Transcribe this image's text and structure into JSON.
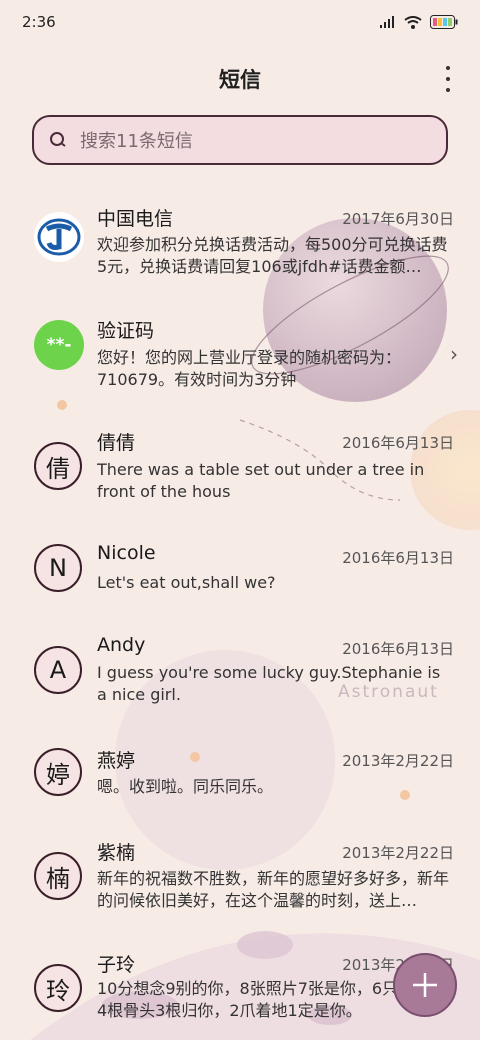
{
  "status_bar": {
    "time": "2:36"
  },
  "header": {
    "title": "短信",
    "more_icon": "more-vert-icon"
  },
  "search": {
    "placeholder": "搜索11条短信"
  },
  "watermark": "Astronaut",
  "messages": [
    {
      "name": "中国电信",
      "date": "2017年6月30日",
      "snippet": "欢迎参加积分兑换话费活动，每500分可兑换话费5元，兑换话费请回复106或jfdh#话费金额…",
      "avatar": "china-telecom-logo"
    },
    {
      "name": "验证码",
      "date": "",
      "snippet": "您好！您的网上营业厅登录的随机密码为：710679。有效时间为3分钟",
      "avatar_text": "**-"
    },
    {
      "name": "倩倩",
      "date": "2016年6月13日",
      "snippet": "There was a table set out under a tree in front of the hous",
      "avatar_text": "倩"
    },
    {
      "name": "Nicole",
      "date": "2016年6月13日",
      "snippet": "Let's eat out,shall we?",
      "avatar_text": "N"
    },
    {
      "name": "Andy",
      "date": "2016年6月13日",
      "snippet": "I guess you're some lucky guy.Stephanie is a nice girl.",
      "avatar_text": "A"
    },
    {
      "name": "燕婷",
      "date": "2013年2月22日",
      "snippet": "嗯。收到啦。同乐同乐。",
      "avatar_text": "婷"
    },
    {
      "name": "紫楠",
      "date": "2013年2月22日",
      "snippet": "新年的祝福数不胜数，新年的愿望好多好多，新年的问候依旧美好，在这个温馨的时刻，送上…",
      "avatar_text": "楠"
    },
    {
      "name": "子玲",
      "date": "2013年2月22日",
      "snippet": "10分想念9别的你，8张照片7张是你，6只像你，4根骨头3根归你，2爪着地1定是你。",
      "avatar_text": "玲"
    }
  ],
  "fab": {
    "icon": "plus-icon"
  }
}
